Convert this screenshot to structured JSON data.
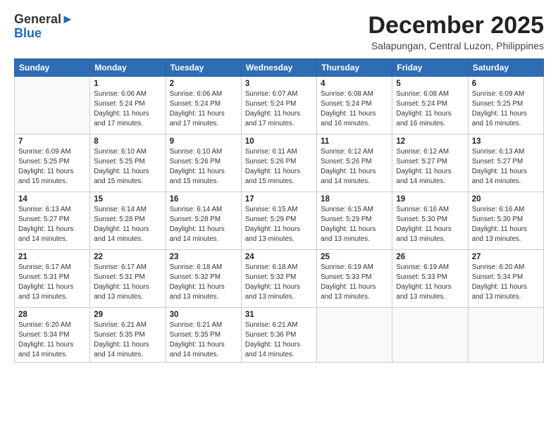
{
  "header": {
    "logo_line1": "General",
    "logo_line2": "Blue",
    "month": "December 2025",
    "location": "Salapungan, Central Luzon, Philippines"
  },
  "weekdays": [
    "Sunday",
    "Monday",
    "Tuesday",
    "Wednesday",
    "Thursday",
    "Friday",
    "Saturday"
  ],
  "weeks": [
    [
      {
        "day": "",
        "info": ""
      },
      {
        "day": "1",
        "info": "Sunrise: 6:06 AM\nSunset: 5:24 PM\nDaylight: 11 hours\nand 17 minutes."
      },
      {
        "day": "2",
        "info": "Sunrise: 6:06 AM\nSunset: 5:24 PM\nDaylight: 11 hours\nand 17 minutes."
      },
      {
        "day": "3",
        "info": "Sunrise: 6:07 AM\nSunset: 5:24 PM\nDaylight: 11 hours\nand 17 minutes."
      },
      {
        "day": "4",
        "info": "Sunrise: 6:08 AM\nSunset: 5:24 PM\nDaylight: 11 hours\nand 16 minutes."
      },
      {
        "day": "5",
        "info": "Sunrise: 6:08 AM\nSunset: 5:24 PM\nDaylight: 11 hours\nand 16 minutes."
      },
      {
        "day": "6",
        "info": "Sunrise: 6:09 AM\nSunset: 5:25 PM\nDaylight: 11 hours\nand 16 minutes."
      }
    ],
    [
      {
        "day": "7",
        "info": "Sunrise: 6:09 AM\nSunset: 5:25 PM\nDaylight: 11 hours\nand 15 minutes."
      },
      {
        "day": "8",
        "info": "Sunrise: 6:10 AM\nSunset: 5:25 PM\nDaylight: 11 hours\nand 15 minutes."
      },
      {
        "day": "9",
        "info": "Sunrise: 6:10 AM\nSunset: 5:26 PM\nDaylight: 11 hours\nand 15 minutes."
      },
      {
        "day": "10",
        "info": "Sunrise: 6:11 AM\nSunset: 5:26 PM\nDaylight: 11 hours\nand 15 minutes."
      },
      {
        "day": "11",
        "info": "Sunrise: 6:12 AM\nSunset: 5:26 PM\nDaylight: 11 hours\nand 14 minutes."
      },
      {
        "day": "12",
        "info": "Sunrise: 6:12 AM\nSunset: 5:27 PM\nDaylight: 11 hours\nand 14 minutes."
      },
      {
        "day": "13",
        "info": "Sunrise: 6:13 AM\nSunset: 5:27 PM\nDaylight: 11 hours\nand 14 minutes."
      }
    ],
    [
      {
        "day": "14",
        "info": "Sunrise: 6:13 AM\nSunset: 5:27 PM\nDaylight: 11 hours\nand 14 minutes."
      },
      {
        "day": "15",
        "info": "Sunrise: 6:14 AM\nSunset: 5:28 PM\nDaylight: 11 hours\nand 14 minutes."
      },
      {
        "day": "16",
        "info": "Sunrise: 6:14 AM\nSunset: 5:28 PM\nDaylight: 11 hours\nand 14 minutes."
      },
      {
        "day": "17",
        "info": "Sunrise: 6:15 AM\nSunset: 5:29 PM\nDaylight: 11 hours\nand 13 minutes."
      },
      {
        "day": "18",
        "info": "Sunrise: 6:15 AM\nSunset: 5:29 PM\nDaylight: 11 hours\nand 13 minutes."
      },
      {
        "day": "19",
        "info": "Sunrise: 6:16 AM\nSunset: 5:30 PM\nDaylight: 11 hours\nand 13 minutes."
      },
      {
        "day": "20",
        "info": "Sunrise: 6:16 AM\nSunset: 5:30 PM\nDaylight: 11 hours\nand 13 minutes."
      }
    ],
    [
      {
        "day": "21",
        "info": "Sunrise: 6:17 AM\nSunset: 5:31 PM\nDaylight: 11 hours\nand 13 minutes."
      },
      {
        "day": "22",
        "info": "Sunrise: 6:17 AM\nSunset: 5:31 PM\nDaylight: 11 hours\nand 13 minutes."
      },
      {
        "day": "23",
        "info": "Sunrise: 6:18 AM\nSunset: 5:32 PM\nDaylight: 11 hours\nand 13 minutes."
      },
      {
        "day": "24",
        "info": "Sunrise: 6:18 AM\nSunset: 5:32 PM\nDaylight: 11 hours\nand 13 minutes."
      },
      {
        "day": "25",
        "info": "Sunrise: 6:19 AM\nSunset: 5:33 PM\nDaylight: 11 hours\nand 13 minutes."
      },
      {
        "day": "26",
        "info": "Sunrise: 6:19 AM\nSunset: 5:33 PM\nDaylight: 11 hours\nand 13 minutes."
      },
      {
        "day": "27",
        "info": "Sunrise: 6:20 AM\nSunset: 5:34 PM\nDaylight: 11 hours\nand 13 minutes."
      }
    ],
    [
      {
        "day": "28",
        "info": "Sunrise: 6:20 AM\nSunset: 5:34 PM\nDaylight: 11 hours\nand 14 minutes."
      },
      {
        "day": "29",
        "info": "Sunrise: 6:21 AM\nSunset: 5:35 PM\nDaylight: 11 hours\nand 14 minutes."
      },
      {
        "day": "30",
        "info": "Sunrise: 6:21 AM\nSunset: 5:35 PM\nDaylight: 11 hours\nand 14 minutes."
      },
      {
        "day": "31",
        "info": "Sunrise: 6:21 AM\nSunset: 5:36 PM\nDaylight: 11 hours\nand 14 minutes."
      },
      {
        "day": "",
        "info": ""
      },
      {
        "day": "",
        "info": ""
      },
      {
        "day": "",
        "info": ""
      }
    ]
  ]
}
